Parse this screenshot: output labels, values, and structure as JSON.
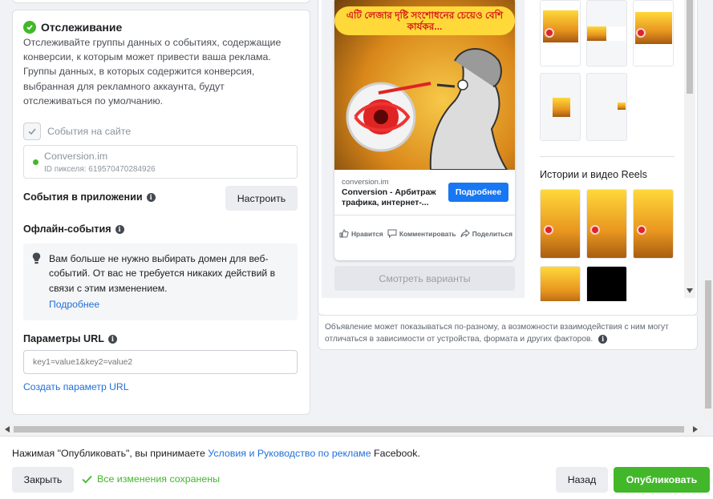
{
  "tracking": {
    "title": "Отслеживание",
    "description": "Отслеживайте группы данных о событиях, содержащие конверсии, к которым может привести ваша реклама. Группы данных, в которых содержится конверсия, выбранная для рекламного аккаунта, будут отслеживаться по умолчанию.",
    "site_events_label": "События на сайте",
    "pixel_name": "Conversion.im",
    "pixel_id": "ID пикселя: 619570470284926",
    "app_events_label": "События в приложении",
    "setup_button": "Настроить",
    "offline_events_label": "Офлайн-события",
    "notice_text": "Вам больше не нужно выбирать домен для веб-событий. От вас не требуется никаких действий в связи с этим изменением.",
    "notice_link": "Подробнее",
    "url_params_label": "Параметры URL",
    "url_input_placeholder": "key1=value1&key2=value2",
    "create_param_link": "Создать параметр URL"
  },
  "preview": {
    "ad_banner_text": "এটি লেজার দৃষ্টি সংশোধনের চেয়েও বেশি কার্যকর...",
    "domain": "conversion.im",
    "headline": "Conversion - Арбитраж трафика, интернет-...",
    "cta": "Подробнее",
    "like": "Нравится",
    "comment": "Комментировать",
    "share": "Поделиться",
    "variants_button": "Смотреть варианты",
    "stories_title": "Истории и видео Reels",
    "disclaimer": "Объявление может показываться по-разному, а возможности взаимодействия с ним могут отличаться в зависимости от устройства, формата и других факторов."
  },
  "footer": {
    "terms_prefix": "Нажимая \"Опубликовать\", вы принимаете ",
    "terms_link": "Условия и Руководство по рекламе",
    "terms_suffix": " Facebook.",
    "close_button": "Закрыть",
    "saved_status": "Все изменения сохранены",
    "back_button": "Назад",
    "publish_button": "Опубликовать"
  },
  "colors": {
    "accent_blue": "#1877f2",
    "success_green": "#42b72a",
    "link_blue": "#216fdb"
  }
}
